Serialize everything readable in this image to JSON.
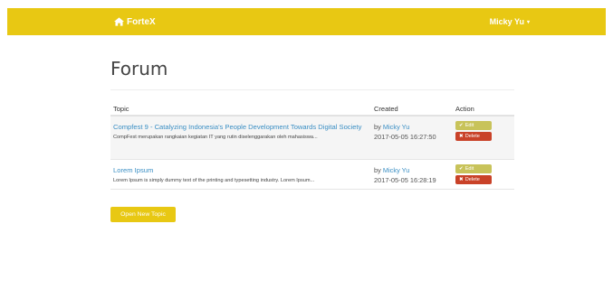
{
  "navbar": {
    "brand": "ForteX",
    "user": "Micky Yu",
    "caret": "▾"
  },
  "page": {
    "title": "Forum"
  },
  "table": {
    "headers": {
      "topic": "Topic",
      "created": "Created",
      "action": "Action"
    },
    "rows": [
      {
        "title": "Compfest 9 - Catalyzing Indonesia's People Development Towards Digital Society",
        "description": "CompFest merupakan rangkaian kegiatan IT yang rutin diselenggarakan oleh mahasiswa...",
        "by_prefix": "by",
        "author": "Micky Yu",
        "created": "2017-05-05 16:27:50",
        "edit_label": "Edit",
        "delete_label": "Delete"
      },
      {
        "title": "Lorem Ipsum",
        "description": "Lorem Ipsum is simply dummy text of the printing and typesetting industry. Lorem Ipsum...",
        "by_prefix": "by",
        "author": "Micky Yu",
        "created": "2017-05-05 16:28:19",
        "edit_label": "Edit",
        "delete_label": "Delete"
      }
    ]
  },
  "actions": {
    "new_topic": "Open New Topic"
  },
  "icons": {
    "home": "home-icon",
    "check": "✔",
    "cross": "✖"
  },
  "colors": {
    "brand": "#e8c813",
    "edit": "#c8c35a",
    "delete": "#c94228",
    "link": "#3b8fc4"
  }
}
